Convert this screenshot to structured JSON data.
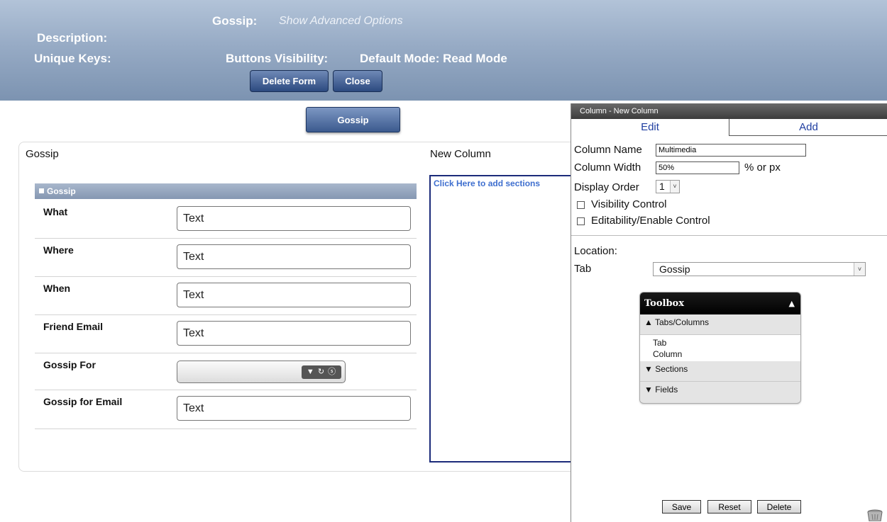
{
  "header": {
    "form_name_label": "Gossip:",
    "advanced_options": "Show Advanced Options",
    "description_label": "Description:",
    "unique_keys_label": "Unique Keys:",
    "buttons_visibility_label": "Buttons Visibility:",
    "default_mode": "Default Mode: Read Mode",
    "delete_form_button": "Delete Form",
    "close_button": "Close"
  },
  "tab": {
    "label": "Gossip"
  },
  "form": {
    "column1_title": "Gossip",
    "column2_title": "New Column",
    "section_title": "Gossip",
    "fields": [
      {
        "label": "What",
        "value": "Text"
      },
      {
        "label": "Where",
        "value": "Text"
      },
      {
        "label": "When",
        "value": "Text"
      },
      {
        "label": "Friend Email",
        "value": "Text"
      },
      {
        "label": "Gossip For",
        "value": ""
      },
      {
        "label": "Gossip for Email",
        "value": "Text"
      }
    ],
    "lookup_controls": "▼ ↻ ⓢ",
    "add_sections_link": "Click Here to add sections"
  },
  "properties": {
    "title": "Column - New Column",
    "tab_edit": "Edit",
    "tab_add": "Add",
    "column_name_label": "Column Name",
    "column_name_value": "Multimedia",
    "column_width_label": "Column Width",
    "column_width_value": "50%",
    "width_unit_hint": "% or px",
    "display_order_label": "Display Order",
    "display_order_value": "1",
    "visibility_control_label": "Visibility Control",
    "editability_control_label": "Editability/Enable Control",
    "location_label": "Location:",
    "tab_label": "Tab",
    "tab_value": "Gossip",
    "toolbox": {
      "title": "Toolbox",
      "tabs_columns_label": "▲ Tabs/Columns",
      "items": [
        "Tab",
        "Column"
      ],
      "sections_label": "▼ Sections",
      "fields_label": "▼ Fields"
    },
    "save_button": "Save",
    "reset_button": "Reset",
    "delete_button": "Delete"
  },
  "colors": {
    "header_gradient_top": "#b2c3d8",
    "header_gradient_bottom": "#7c93b1",
    "button_blue": "#2c4a80",
    "link_blue": "#3f6fcf",
    "column_border": "#1c2b7a"
  }
}
